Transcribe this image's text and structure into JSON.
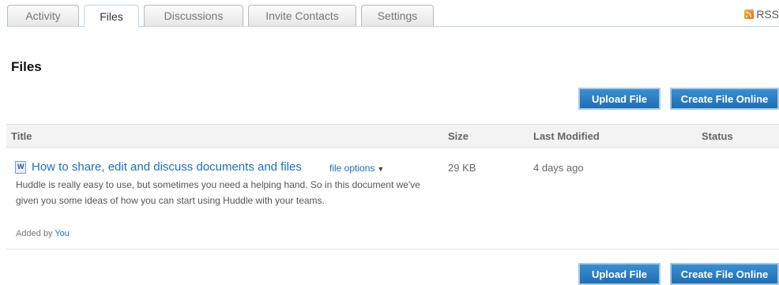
{
  "tabs": [
    {
      "label": "Activity",
      "active": false
    },
    {
      "label": "Files",
      "active": true
    },
    {
      "label": "Discussions",
      "active": false
    },
    {
      "label": "Invite Contacts",
      "active": false
    },
    {
      "label": "Settings",
      "active": false
    }
  ],
  "rss": {
    "label": "RSS",
    "icon": "rss-icon"
  },
  "page": {
    "title": "Files"
  },
  "buttons": {
    "upload": "Upload File",
    "create": "Create File Online"
  },
  "table": {
    "columns": [
      "Title",
      "Size",
      "Last Modified",
      "Status"
    ],
    "rows": [
      {
        "icon": "word-document-icon",
        "title": "How to share, edit and discuss documents and files",
        "options_label": "file options",
        "description": "Huddle is really easy to use, but sometimes you need a helping hand. So in this document we've given you some ideas of how you can start using Huddle with your teams.",
        "added_by_prefix": "Added by",
        "added_by_user": "You",
        "size": "29 KB",
        "modified": "4 days ago",
        "status": ""
      }
    ]
  },
  "colors": {
    "accent": "#1d6fb8",
    "button": "#2a7fc4",
    "tab_border": "#bcd7ec"
  }
}
